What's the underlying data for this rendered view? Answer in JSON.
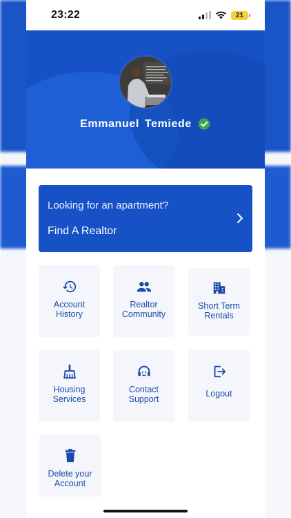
{
  "status_bar": {
    "time": "23:22",
    "battery": "21"
  },
  "profile": {
    "name": "Emmanuel  Temiede",
    "verified_icon": "verified-badge-icon"
  },
  "banner": {
    "question": "Looking for an apartment?",
    "action": "Find A Realtor"
  },
  "menu": [
    {
      "label": "Account\nHistory",
      "icon": "history-icon"
    },
    {
      "label": "Realtor\nCommunity",
      "icon": "people-icon"
    },
    {
      "label": "Short Term\nRentals",
      "icon": "building-icon"
    },
    {
      "label": "Housing\nServices",
      "icon": "broom-icon"
    },
    {
      "label": "Contact\nSupport",
      "icon": "headset-icon"
    },
    {
      "label": "Logout",
      "icon": "logout-icon"
    },
    {
      "label": "Delete your\nAccount",
      "icon": "trash-icon"
    }
  ],
  "colors": {
    "primary": "#1652c6",
    "tile_bg": "#f4f6fc",
    "tile_text": "#1c49a8",
    "verified": "#3aa655"
  }
}
